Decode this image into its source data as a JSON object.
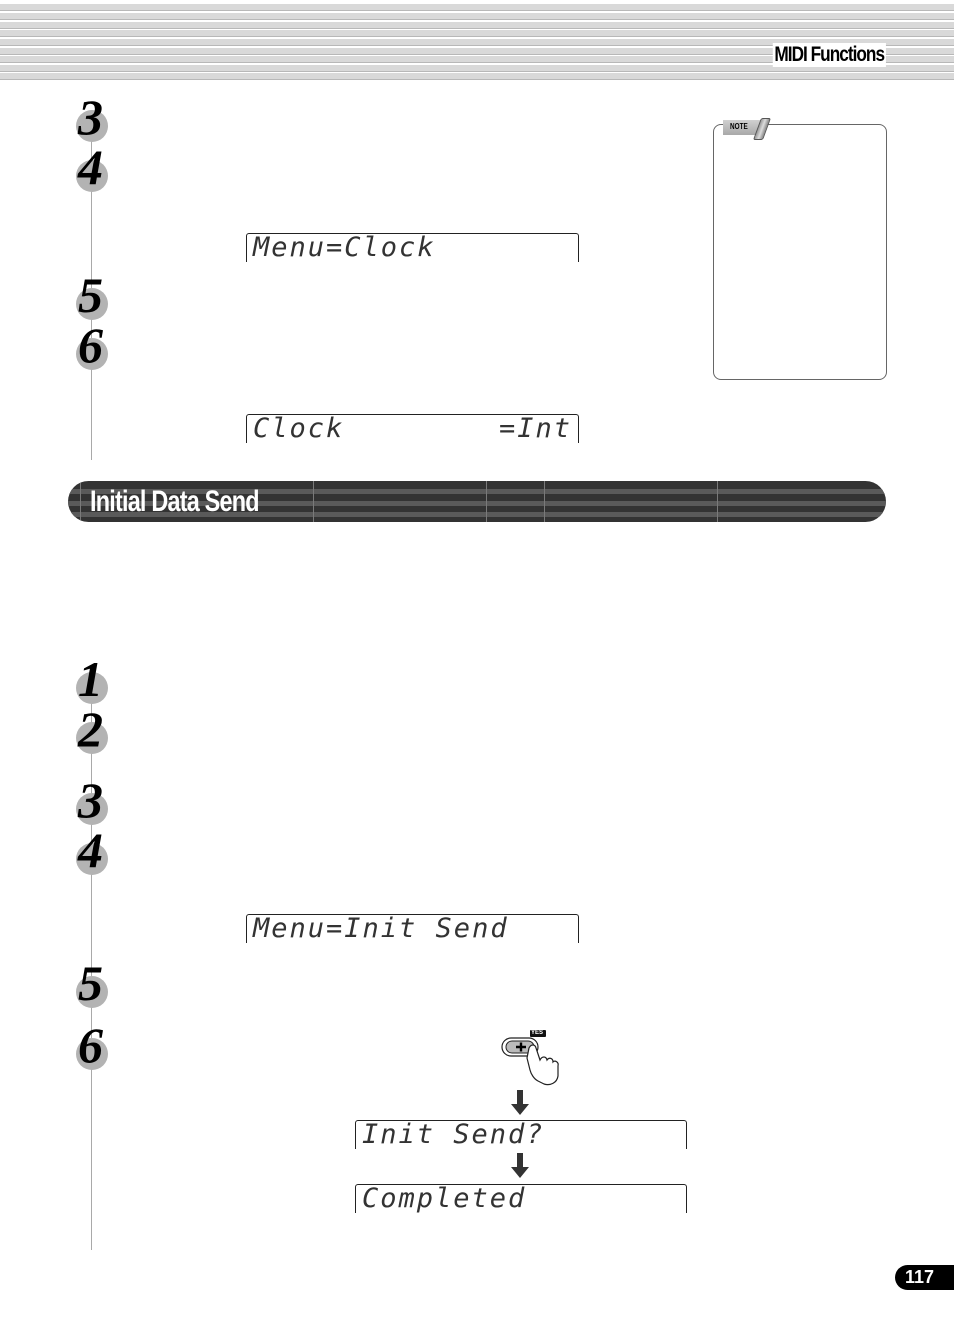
{
  "header": {
    "section": "MIDI Functions"
  },
  "clock_section": {
    "steps": [
      "3",
      "4",
      "5",
      "6"
    ],
    "lcd_menu": {
      "left": "Menu=Clock",
      "right": ""
    },
    "lcd_value": {
      "left": "Clock",
      "right": "=Int"
    }
  },
  "note": {
    "label": "NOTE"
  },
  "init_section": {
    "title": "Initial Data Send",
    "steps": [
      "1",
      "2",
      "3",
      "4",
      "5",
      "6"
    ],
    "lcd_menu": {
      "left": "Menu=Init Send",
      "right": ""
    },
    "button": {
      "badge": "YES",
      "symbol": "+"
    },
    "lcd_confirm": {
      "left": "Init Send?",
      "right": ""
    },
    "lcd_done": {
      "left": "Completed",
      "right": ""
    }
  },
  "footer": {
    "page_number": "117"
  },
  "colors": {
    "banner_dark": "#333333",
    "banner_band": "#5a5a5a",
    "step_circle": "#b3b3b3",
    "header_stripe": "#d9d9d9"
  }
}
